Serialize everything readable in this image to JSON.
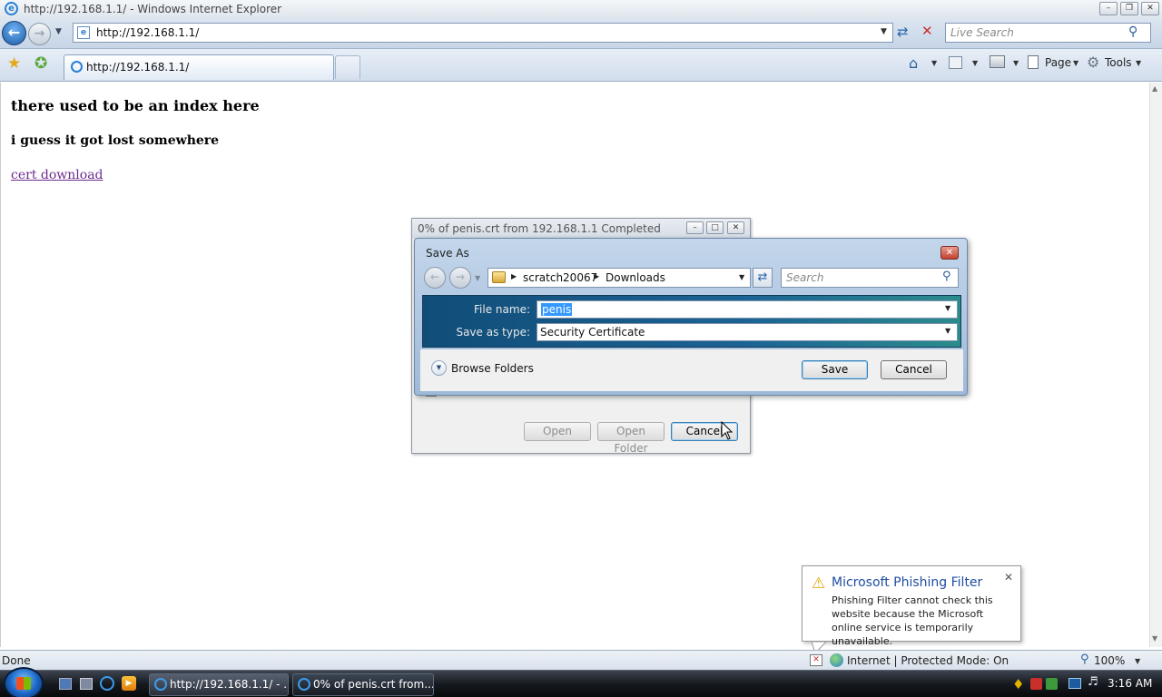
{
  "window": {
    "title": "http://192.168.1.1/ - Windows Internet Explorer",
    "address": "http://192.168.1.1/",
    "search_placeholder": "Live Search",
    "tab_label": "http://192.168.1.1/",
    "toolbar": {
      "page": "Page",
      "tools": "Tools"
    }
  },
  "page": {
    "heading": "there used to be an index here",
    "subheading": "i guess it got lost somewhere",
    "link": "cert download"
  },
  "download_dialog": {
    "title": "0% of penis.crt from 192.168.1.1 Completed",
    "buttons": {
      "open": "Open",
      "open_folder": "Open Folder",
      "cancel": "Cancel"
    }
  },
  "save_as": {
    "title": "Save As",
    "breadcrumb": [
      "scratch20067",
      "Downloads"
    ],
    "search_placeholder": "Search",
    "file_name_label": "File name:",
    "file_name_value": "penis",
    "save_type_label": "Save as type:",
    "save_type_value": "Security Certificate",
    "browse_folders": "Browse Folders",
    "save": "Save",
    "cancel": "Cancel"
  },
  "phishing": {
    "title": "Microsoft Phishing Filter",
    "text": "Phishing Filter cannot check this website because the Microsoft online service is temporarily unavailable."
  },
  "status": {
    "left": "Done",
    "zone": "Internet | Protected Mode: On",
    "zoom": "100%"
  },
  "taskbar": {
    "items": [
      "http://192.168.1.1/ - ...",
      "0% of penis.crt from..."
    ],
    "clock": "3:16 AM"
  }
}
